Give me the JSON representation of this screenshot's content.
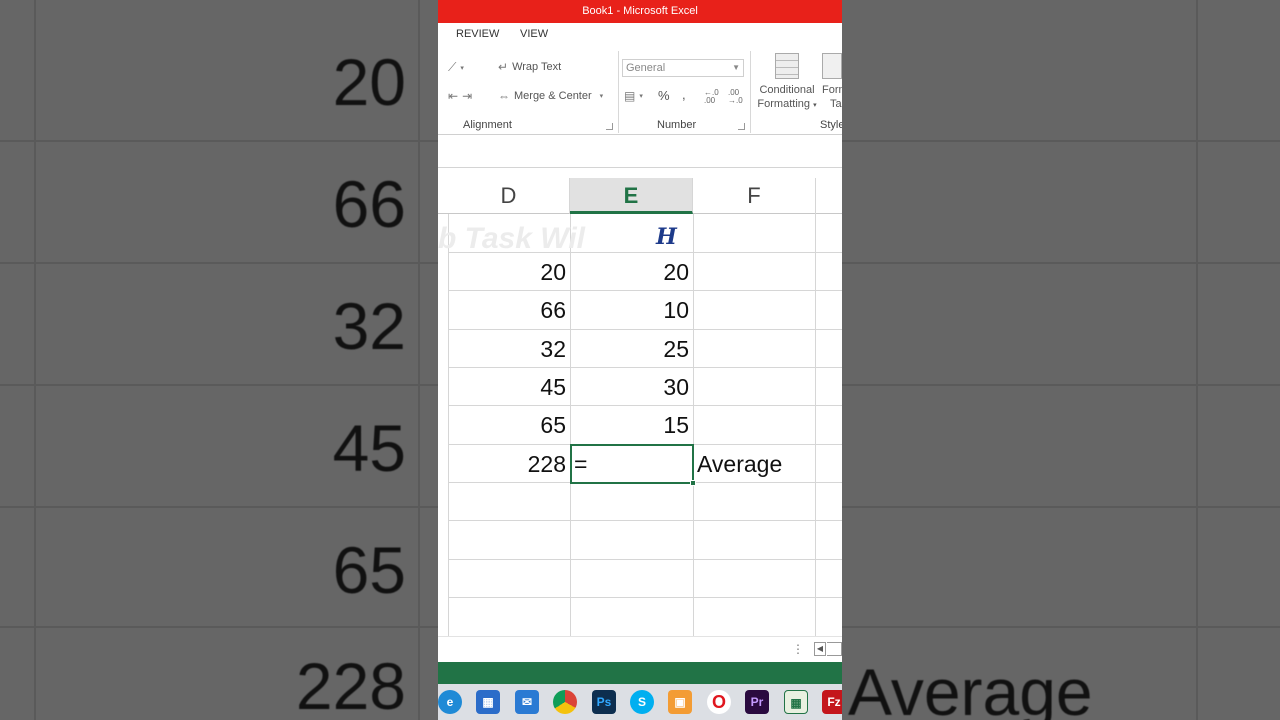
{
  "window": {
    "title": "Book1 -  Microsoft Excel"
  },
  "ribbon_tabs": [
    "REVIEW",
    "VIEW"
  ],
  "ribbon": {
    "alignment": {
      "label": "Alignment",
      "wrap_text": "Wrap Text",
      "merge_center": "Merge & Center"
    },
    "number": {
      "label": "Number",
      "format_value": "General",
      "percent": "%",
      "comma": ",",
      "increase_decimal": "←.0 .00",
      "decrease_decimal": ".00 →.0"
    },
    "styles": {
      "label": "Style",
      "conditional_formatting_line1": "Conditional",
      "conditional_formatting_line2": "Formatting",
      "format_as_table_line1": "Form",
      "format_as_table_line2": "Ta"
    }
  },
  "columns": [
    "D",
    "E",
    "F"
  ],
  "active_column": "E",
  "watermark": "b Task Wil",
  "header_logo": "H",
  "rows": [
    {
      "D": "20",
      "E": "20",
      "F": ""
    },
    {
      "D": "66",
      "E": "10",
      "F": ""
    },
    {
      "D": "32",
      "E": "25",
      "F": ""
    },
    {
      "D": "45",
      "E": "30",
      "F": ""
    },
    {
      "D": "65",
      "E": "15",
      "F": ""
    },
    {
      "D": "228",
      "E": "=",
      "F": "Average"
    }
  ],
  "background": {
    "numbers": [
      "20",
      "66",
      "32",
      "45",
      "65",
      "228"
    ],
    "word": "Average"
  },
  "taskbar_icons": [
    "edge-icon",
    "store-icon",
    "mail-icon",
    "chrome-icon",
    "photoshop-icon",
    "skype-icon",
    "app-icon",
    "opera-icon",
    "premiere-icon",
    "excel-icon",
    "filezilla-icon"
  ],
  "colors": {
    "title_bar": "#e8211a",
    "excel_green": "#217346"
  }
}
